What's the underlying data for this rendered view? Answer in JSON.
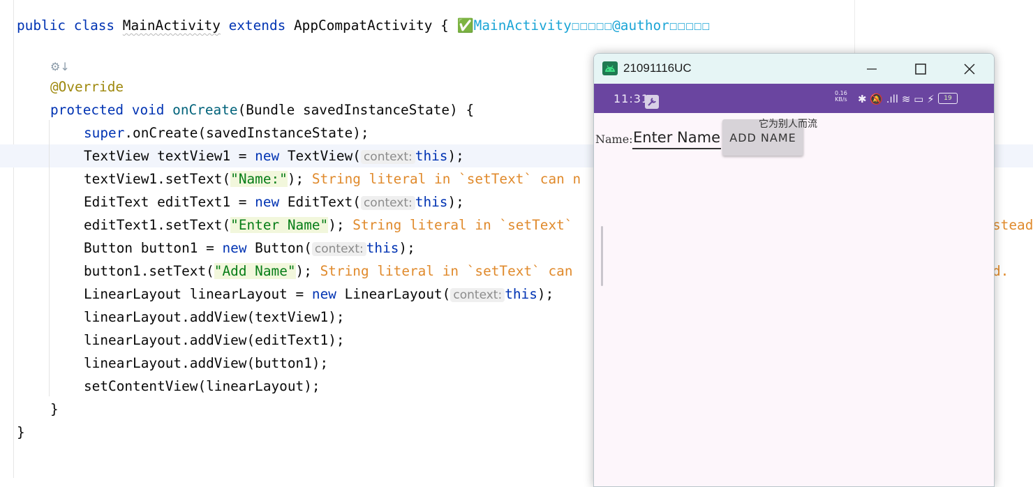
{
  "code": {
    "line1": {
      "kw_public": "public",
      "kw_class": "class",
      "class_name": "MainActivity",
      "kw_extends": "extends",
      "parent": "AppCompatActivity",
      "brace": "{",
      "ghost_comment": "✅MainActivity☐☐☐☐☐@author☐☐☐☐☐"
    },
    "gutter_icon": "⚙↓",
    "line3": {
      "annotation": "@Override"
    },
    "line4": {
      "kw_protected": "protected",
      "kw_void": "void",
      "method": "onCreate",
      "params": "(Bundle savedInstanceState) {"
    },
    "line5": {
      "kw_super": "super",
      "rest": ".onCreate(savedInstanceState);"
    },
    "line6": {
      "pre": "TextView textView1 = ",
      "kw_new": "new",
      "mid": " TextView(",
      "hint": "context:",
      "kw_this": "this",
      "post": ");"
    },
    "line7": {
      "pre": "textView1.setText(",
      "str": "\"Name:\"",
      "post": ");",
      "warn": "String literal in `setText` can n"
    },
    "line8": {
      "pre": "EditText editText1 = ",
      "kw_new": "new",
      "mid": " EditText(",
      "hint": "context:",
      "kw_this": "this",
      "post": ");"
    },
    "line9": {
      "pre": "editText1.setText(",
      "str": "\"Enter Name\"",
      "post": ");",
      "warn": "String literal in `setText`",
      "warn_tail": "stead"
    },
    "line10": {
      "pre": "Button button1 = ",
      "kw_new": "new",
      "mid": " Button(",
      "hint": "context:",
      "kw_this": "this",
      "post": ");"
    },
    "line11": {
      "pre": "button1.setText(",
      "str": "\"Add Name\"",
      "post": ");",
      "warn": "String literal in `setText` can",
      "warn_tail": "d."
    },
    "line12": {
      "pre": "LinearLayout linearLayout = ",
      "kw_new": "new",
      "mid": " LinearLayout(",
      "hint": "context:",
      "kw_this": "this",
      "post": ");"
    },
    "line13": "linearLayout.addView(textView1);",
    "line14": "linearLayout.addView(editText1);",
    "line15": "linearLayout.addView(button1);",
    "line16": "setContentView(linearLayout);",
    "line17": "}",
    "line18": "}"
  },
  "emulator": {
    "title": "21091116UC",
    "clock": "11:31",
    "net_speed_value": "0.16",
    "net_speed_unit": "KB/s",
    "status_icons": "✱ 🔕 .ıll ≋ ▭ ⚡",
    "battery_level": "19",
    "app": {
      "label": "Name:",
      "edit_value": "Enter Name",
      "button": "ADD NAME",
      "watermark": "它为别人而流"
    }
  },
  "colors": {
    "status_bar": "#6a45a0",
    "title_bar": "#e6f5f5",
    "keyword": "#0033b3",
    "string": "#067d17",
    "warning": "#e08a2c"
  }
}
